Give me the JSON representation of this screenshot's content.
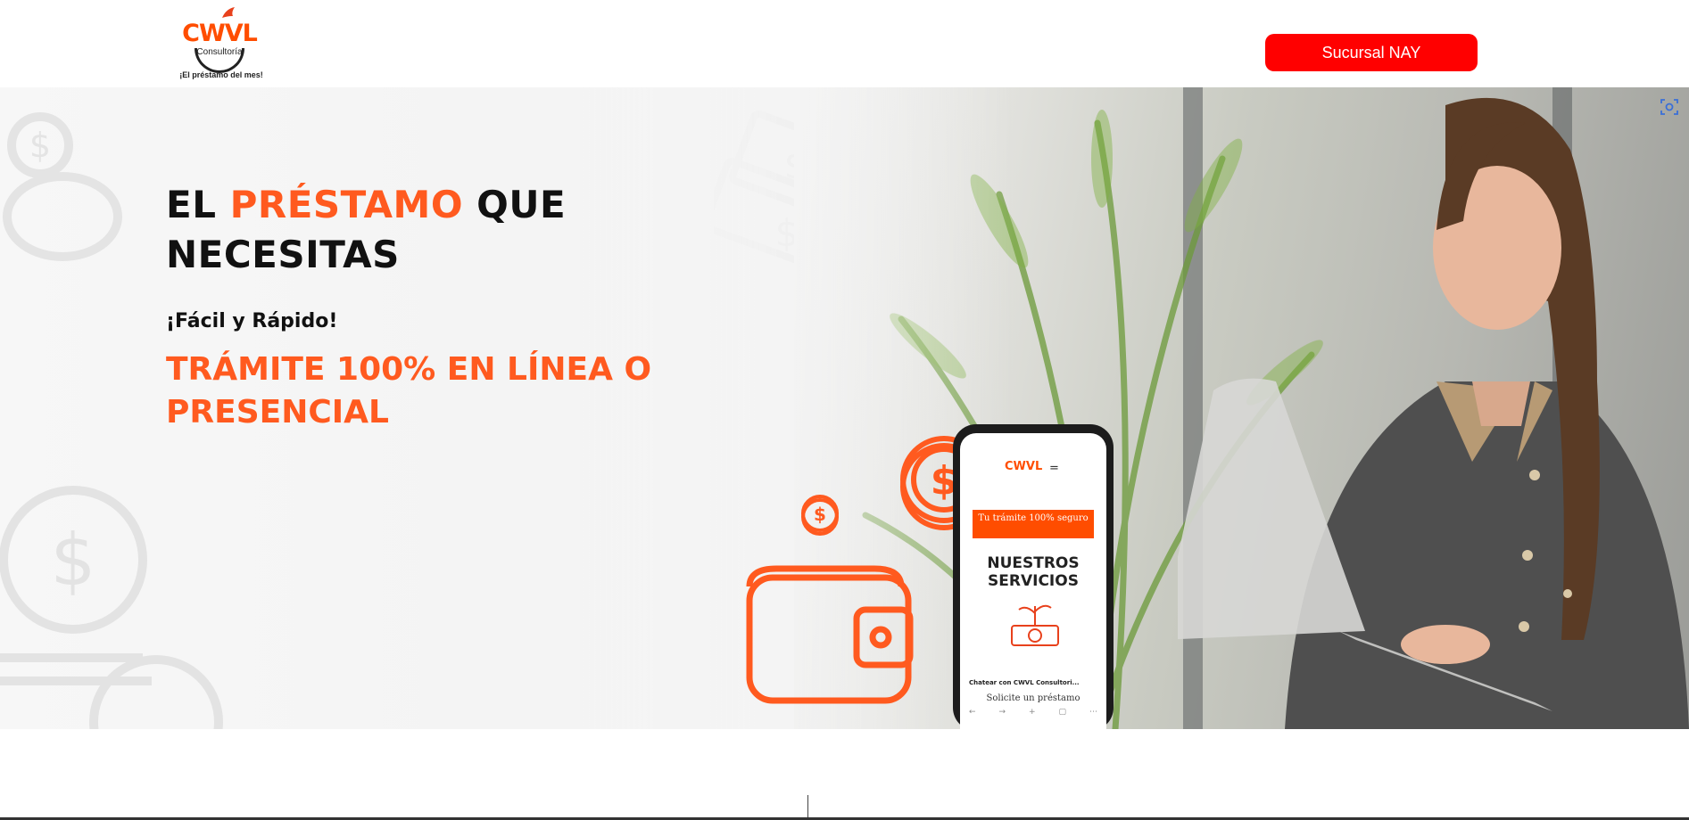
{
  "header": {
    "logo": {
      "brand": "CWVL",
      "subtitle": "Consultoría",
      "tagline": "¡El préstamo del mes!"
    },
    "branch_button": "Sucursal NAY"
  },
  "hero": {
    "headline": {
      "part1": "EL ",
      "accent": "PRÉSTAMO",
      "part2": " QUE NECESITAS"
    },
    "tagline": "¡Fácil y Rápido!",
    "cta_text": "TRÁMITE 100% EN LÍNEA O PRESENCIAL",
    "phone": {
      "logo": "CWVL",
      "menu": "=",
      "banner": "Tu trámite 100% seguro",
      "title": "NUESTROS SERVICIOS",
      "chat": "Chatear con CWVL Consultori...",
      "cta": "Solicite un préstamo"
    }
  },
  "colors": {
    "accent": "#ff5a1f",
    "button": "#ff0000",
    "text": "#111111"
  },
  "icons": [
    "dollar-coin-icon",
    "wallet-icon",
    "piggy-bank-icon",
    "money-bill-icon",
    "scan-icon",
    "bird-icon"
  ]
}
